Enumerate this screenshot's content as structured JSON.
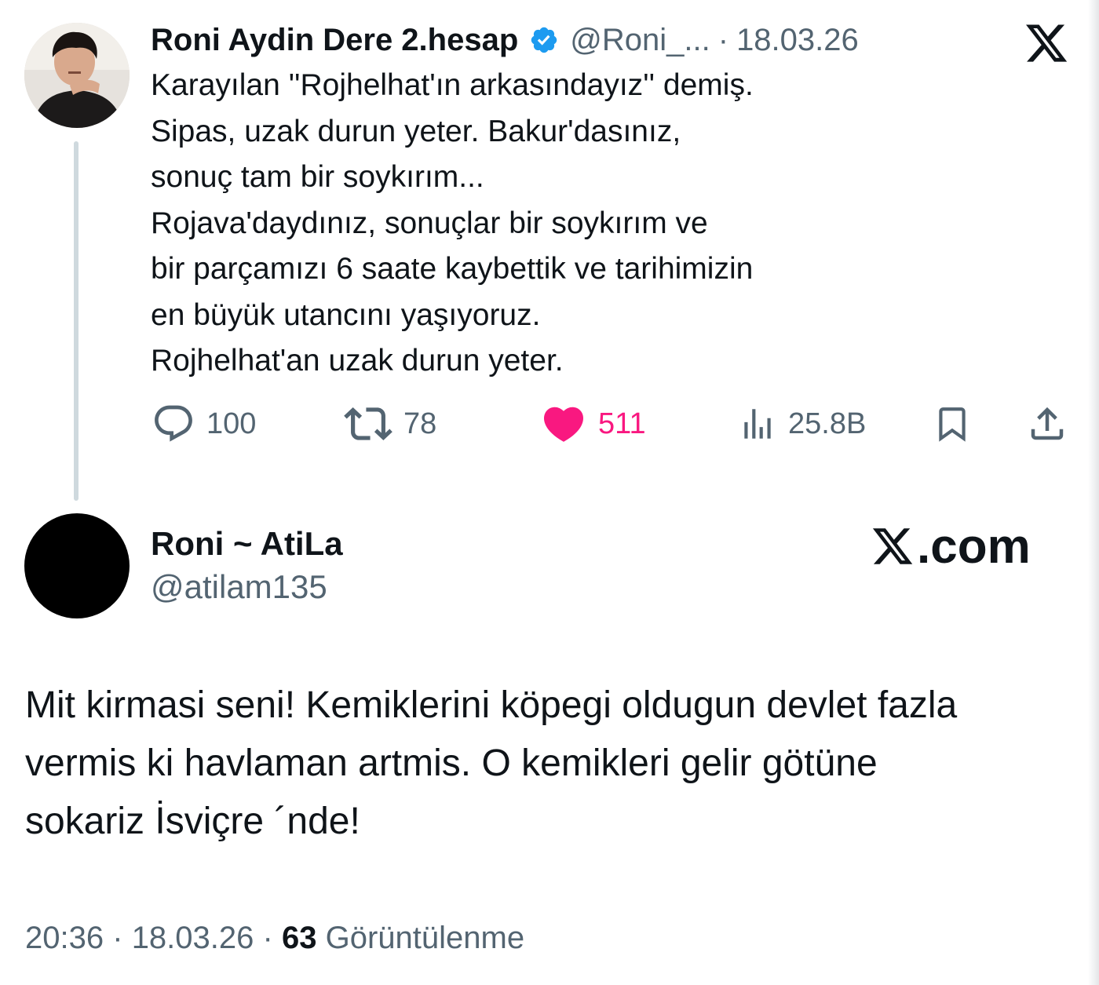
{
  "quoted_tweet": {
    "display_name": "Roni Aydin Dere 2.hesap",
    "handle": "@Roni_...",
    "separator": "·",
    "date": "18.03.26",
    "body_lines": [
      "Karayılan ''Rojhelhat'ın arkasındayız'' demiş.",
      "Sipas, uzak durun yeter.  Bakur'dasınız,",
      "sonuç tam bir soykırım...",
      "Rojava'daydınız, sonuçlar bir soykırım ve",
      "bir parçamızı 6 saate kaybettik ve tarihimizin",
      "en büyük utancını yaşıyoruz.",
      "Rojhelhat'an uzak durun yeter."
    ],
    "actions": {
      "replies": "100",
      "retweets": "78",
      "likes": "511",
      "views": "25.8B"
    },
    "colors": {
      "like_active": "#f91880",
      "verified": "#1d9bf0",
      "secondary_text": "#536471"
    }
  },
  "reply_tweet": {
    "display_name": "Roni ~ AtiLa",
    "handle": "@atilam135",
    "body_lines": [
      "Mit kirmasi seni! Kemiklerini köpegi oldugun devlet fazla",
      "vermis ki havlaman artmis. O kemikleri gelir götüne",
      "sokariz İsviçre ´nde!"
    ],
    "footer": {
      "time": "20:36",
      "separator": "·",
      "date": "18.03.26",
      "views_count": "63",
      "views_label": "Görüntülenme"
    }
  },
  "branding": {
    "site": ".com",
    "logo_icon": "x-logo-icon"
  }
}
